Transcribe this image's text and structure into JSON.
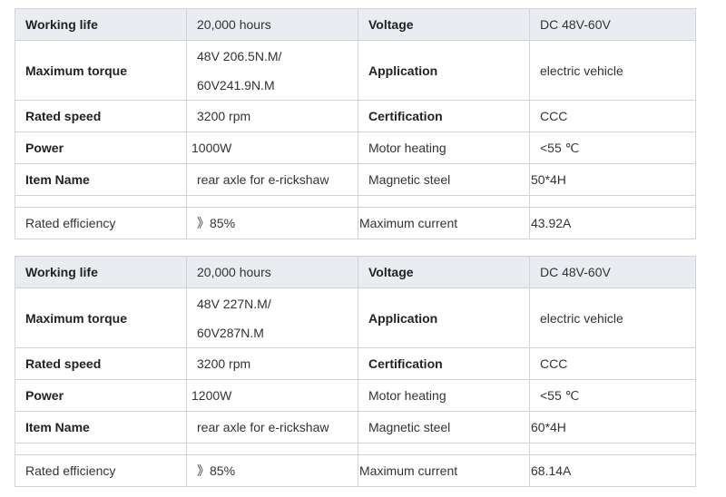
{
  "tables": [
    {
      "working_life_label": "Working life",
      "working_life": "20,000 hours",
      "voltage_label": "Voltage",
      "voltage": "DC 48V-60V",
      "max_torque_label": "Maximum torque",
      "max_torque_line1": "48V 206.5N.M/",
      "max_torque_line2": "60V241.9N.M",
      "application_label": "Application",
      "application": "electric vehicle",
      "rated_speed_label": "Rated speed",
      "rated_speed": "3200 rpm",
      "certification_label": "Certification",
      "certification": "CCC",
      "power_label": "Power",
      "power": "1000W",
      "motor_heating_label": "Motor heating",
      "motor_heating": "<55 ℃",
      "item_name_label": "Item Name",
      "item_name": "rear axle for e-rickshaw",
      "magnetic_steel_label": "Magnetic steel",
      "magnetic_steel": "50*4H",
      "rated_efficiency_label": "Rated efficiency",
      "rated_efficiency": "》85%",
      "max_current_label": "Maximum current",
      "max_current": "43.92A"
    },
    {
      "working_life_label": "Working life",
      "working_life": "20,000 hours",
      "voltage_label": "Voltage",
      "voltage": "DC 48V-60V",
      "max_torque_label": "Maximum torque",
      "max_torque_line1": "48V 227N.M/",
      "max_torque_line2": "60V287N.M",
      "application_label": "Application",
      "application": "electric vehicle",
      "rated_speed_label": "Rated speed",
      "rated_speed": "3200 rpm",
      "certification_label": "Certification",
      "certification": "CCC",
      "power_label": "Power",
      "power": "1200W",
      "motor_heating_label": "Motor heating",
      "motor_heating": "<55 ℃",
      "item_name_label": "Item Name",
      "item_name": "rear axle for e-rickshaw",
      "magnetic_steel_label": "Magnetic steel",
      "magnetic_steel": "60*4H",
      "rated_efficiency_label": "Rated efficiency",
      "rated_efficiency": "》85%",
      "max_current_label": "Maximum current",
      "max_current": "68.14A"
    }
  ]
}
